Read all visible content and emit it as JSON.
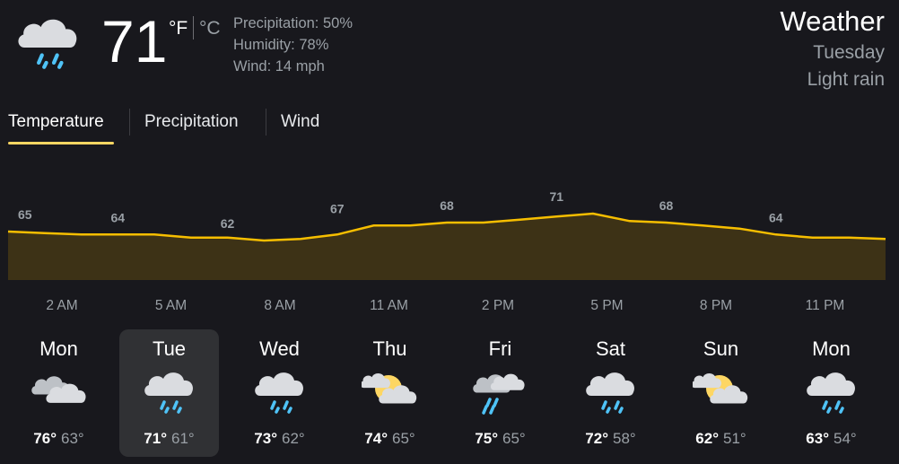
{
  "current": {
    "temp": "71",
    "unit_f": "°F",
    "unit_c": "°C",
    "precipitation": "Precipitation: 50%",
    "humidity": "Humidity: 78%",
    "wind": "Wind: 14 mph",
    "icon": "rain-cloud-icon"
  },
  "title": {
    "heading": "Weather",
    "day": "Tuesday",
    "condition": "Light rain"
  },
  "tabs": [
    {
      "label": "Temperature",
      "active": true
    },
    {
      "label": "Precipitation",
      "active": false
    },
    {
      "label": "Wind",
      "active": false
    }
  ],
  "colors": {
    "accent": "#fdd663",
    "chart_line": "#f6be00",
    "chart_fill": "#3d3216",
    "selected_day_bg": "#303134"
  },
  "chart_data": {
    "type": "area",
    "x": [
      0,
      1,
      2,
      3,
      4,
      5,
      6,
      7,
      8,
      9,
      10,
      11,
      12,
      13,
      14,
      15,
      16,
      17,
      18,
      19,
      20,
      21,
      22,
      23,
      24
    ],
    "values": [
      65,
      64.5,
      64,
      64,
      64,
      63,
      63,
      62,
      62.5,
      64,
      67,
      67,
      68,
      68,
      69,
      70,
      71,
      68.5,
      68,
      67,
      66,
      64,
      63,
      63,
      62.5
    ],
    "labels": [
      {
        "x": 0,
        "value": "65"
      },
      {
        "x": 3,
        "value": "64"
      },
      {
        "x": 6,
        "value": "62"
      },
      {
        "x": 9,
        "value": "67"
      },
      {
        "x": 12,
        "value": "68"
      },
      {
        "x": 15,
        "value": "71"
      },
      {
        "x": 18,
        "value": "68"
      },
      {
        "x": 21,
        "value": "64"
      }
    ],
    "hour_labels": [
      "2 AM",
      "5 AM",
      "8 AM",
      "11 AM",
      "2 PM",
      "5 PM",
      "8 PM",
      "11 PM"
    ],
    "ylim": [
      40,
      73
    ]
  },
  "days": [
    {
      "name": "Mon",
      "high": "76°",
      "low": "63°",
      "icon": "cloudy-icon"
    },
    {
      "name": "Tue",
      "high": "71°",
      "low": "61°",
      "icon": "rain-cloud-icon",
      "selected": true
    },
    {
      "name": "Wed",
      "high": "73°",
      "low": "62°",
      "icon": "rain-cloud-icon"
    },
    {
      "name": "Thu",
      "high": "74°",
      "low": "65°",
      "icon": "partly-sunny-icon"
    },
    {
      "name": "Fri",
      "high": "75°",
      "low": "65°",
      "icon": "rain-clouds-icon"
    },
    {
      "name": "Sat",
      "high": "72°",
      "low": "58°",
      "icon": "rain-cloud-icon"
    },
    {
      "name": "Sun",
      "high": "62°",
      "low": "51°",
      "icon": "partly-sunny-icon"
    },
    {
      "name": "Mon",
      "high": "63°",
      "low": "54°",
      "icon": "rain-cloud-icon"
    }
  ]
}
